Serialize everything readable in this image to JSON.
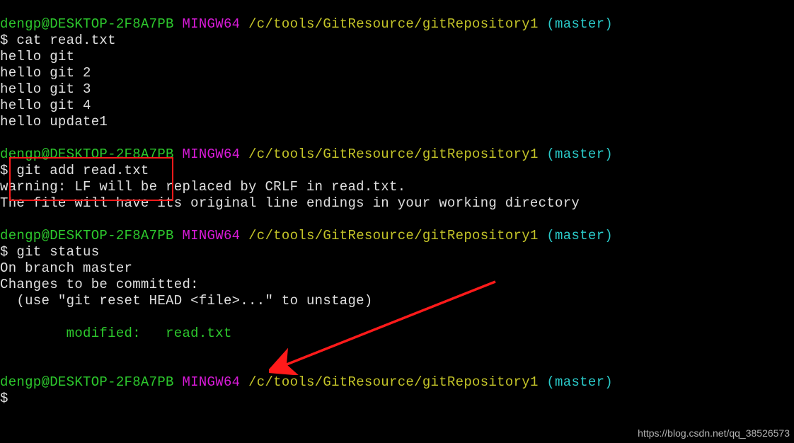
{
  "prompt1": {
    "user": "dengp@DESKTOP-2F8A7PB",
    "env": "MINGW64",
    "path": "/c/tools/GitResource/gitRepository1",
    "branch": "(master)",
    "cmd": "$ cat read.txt"
  },
  "output1": {
    "l1": "hello git",
    "l2": "hello git 2",
    "l3": "hello git 3",
    "l4": "hello git 4",
    "l5": "hello update1"
  },
  "prompt2": {
    "user": "dengp@DESKTOP-2F8A7PB",
    "env": "MINGW64",
    "path": "/c/tools/GitResource/gitRepository1",
    "branch": "(master)",
    "cmd": "$ git add read.txt"
  },
  "output2": {
    "l1": "warning: LF will be replaced by CRLF in read.txt.",
    "l2": "The file will have its original line endings in your working directory"
  },
  "prompt3": {
    "user": "dengp@DESKTOP-2F8A7PB",
    "env": "MINGW64",
    "path": "/c/tools/GitResource/gitRepository1",
    "branch": "(master)",
    "cmd": "$ git status"
  },
  "output3": {
    "l1": "On branch master",
    "l2": "Changes to be committed:",
    "l3": "  (use \"git reset HEAD <file>...\" to unstage)",
    "l4": "        modified:   read.txt"
  },
  "prompt4": {
    "user": "dengp@DESKTOP-2F8A7PB",
    "env": "MINGW64",
    "path": "/c/tools/GitResource/gitRepository1",
    "branch": "(master)",
    "cmd": "$ "
  },
  "watermark": "https://blog.csdn.net/qq_38526573"
}
